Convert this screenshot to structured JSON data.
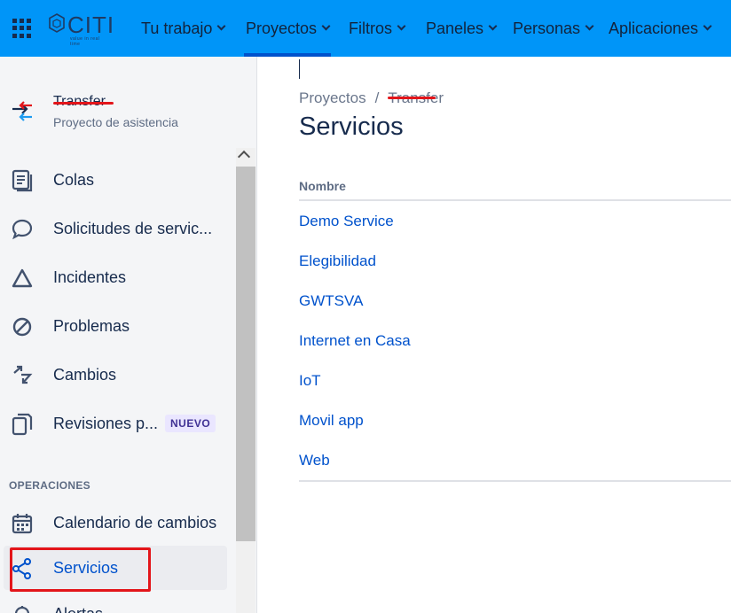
{
  "topnav": {
    "logo_text": "CITI",
    "logo_tagline": "value in real time",
    "items": [
      {
        "label": "Tu trabajo",
        "active": false
      },
      {
        "label": "Proyectos",
        "active": true
      },
      {
        "label": "Filtros",
        "active": false
      },
      {
        "label": "Paneles",
        "active": false
      },
      {
        "label": "Personas",
        "active": false
      },
      {
        "label": "Aplicaciones",
        "active": false
      }
    ]
  },
  "sidebar": {
    "project_name": "Transfer",
    "project_type": "Proyecto de asistencia",
    "items": [
      {
        "label": "Colas",
        "icon": "queue-icon"
      },
      {
        "label": "Solicitudes de servic...",
        "icon": "speech-bubble-icon"
      },
      {
        "label": "Incidentes",
        "icon": "triangle-icon"
      },
      {
        "label": "Problemas",
        "icon": "prohibited-icon"
      },
      {
        "label": "Cambios",
        "icon": "change-arrows-icon"
      },
      {
        "label": "Revisiones p...",
        "icon": "documents-icon",
        "badge": "NUEVO"
      }
    ],
    "section_operations": "OPERACIONES",
    "operations_items": [
      {
        "label": "Calendario de cambios",
        "icon": "calendar-icon"
      },
      {
        "label": "Servicios",
        "icon": "services-icon",
        "selected": true
      },
      {
        "label": "Alertas",
        "icon": "bell-icon"
      }
    ]
  },
  "main": {
    "breadcrumb": {
      "root": "Proyectos",
      "separator": "/",
      "current": "Transfer"
    },
    "title": "Servicios",
    "column_header": "Nombre",
    "services": [
      "Demo Service",
      "Elegibilidad",
      "GWTSVA",
      "Internet en Casa",
      "IoT",
      "Movil app",
      "Web"
    ]
  },
  "colors": {
    "topnav_bg": "#0095f8",
    "link": "#0052cc",
    "annotation_red": "#e3151a",
    "badge_bg": "#eae6ff"
  }
}
